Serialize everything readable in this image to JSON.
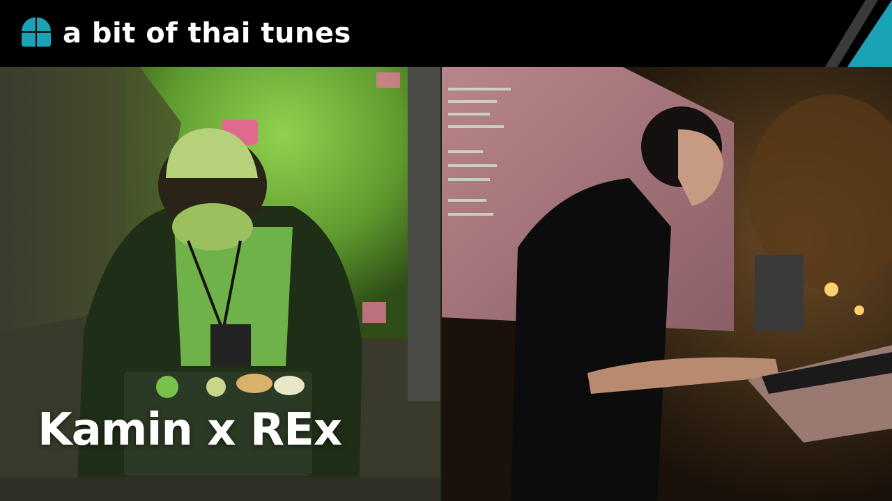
{
  "header": {
    "title": "a bit of thai tunes",
    "logo_icon": "quarter-circles-logo-icon",
    "accent_color": "#19a3b5"
  },
  "photos": {
    "left": {
      "description_icon": "performer-at-laptop-photo"
    },
    "right": {
      "description_icon": "performer-at-keyboard-photo"
    }
  },
  "caption": {
    "text": "Kamin x REx"
  }
}
